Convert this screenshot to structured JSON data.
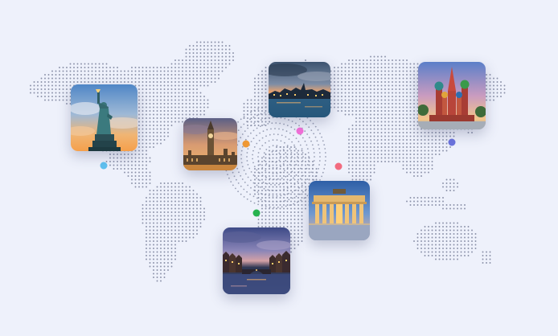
{
  "map": {
    "dot_color": "#8a90a8",
    "background": "#eef1fb"
  },
  "destinations": [
    {
      "id": "new-york",
      "icon": "statue-of-liberty-photo"
    },
    {
      "id": "london",
      "icon": "big-ben-photo"
    },
    {
      "id": "stockholm",
      "icon": "city-waterfront-photo"
    },
    {
      "id": "moscow",
      "icon": "st-basils-cathedral-photo"
    },
    {
      "id": "berlin",
      "icon": "brandenburg-gate-photo"
    },
    {
      "id": "amsterdam",
      "icon": "canal-photo"
    }
  ],
  "markers": [
    {
      "id": "marker-cyan",
      "color": "#5fc0ef"
    },
    {
      "id": "marker-orange",
      "color": "#f39b33"
    },
    {
      "id": "marker-pink",
      "color": "#f26fd8"
    },
    {
      "id": "marker-indigo",
      "color": "#6b73dd"
    },
    {
      "id": "marker-coral",
      "color": "#f26b7f"
    },
    {
      "id": "marker-green",
      "color": "#27b24f"
    }
  ]
}
